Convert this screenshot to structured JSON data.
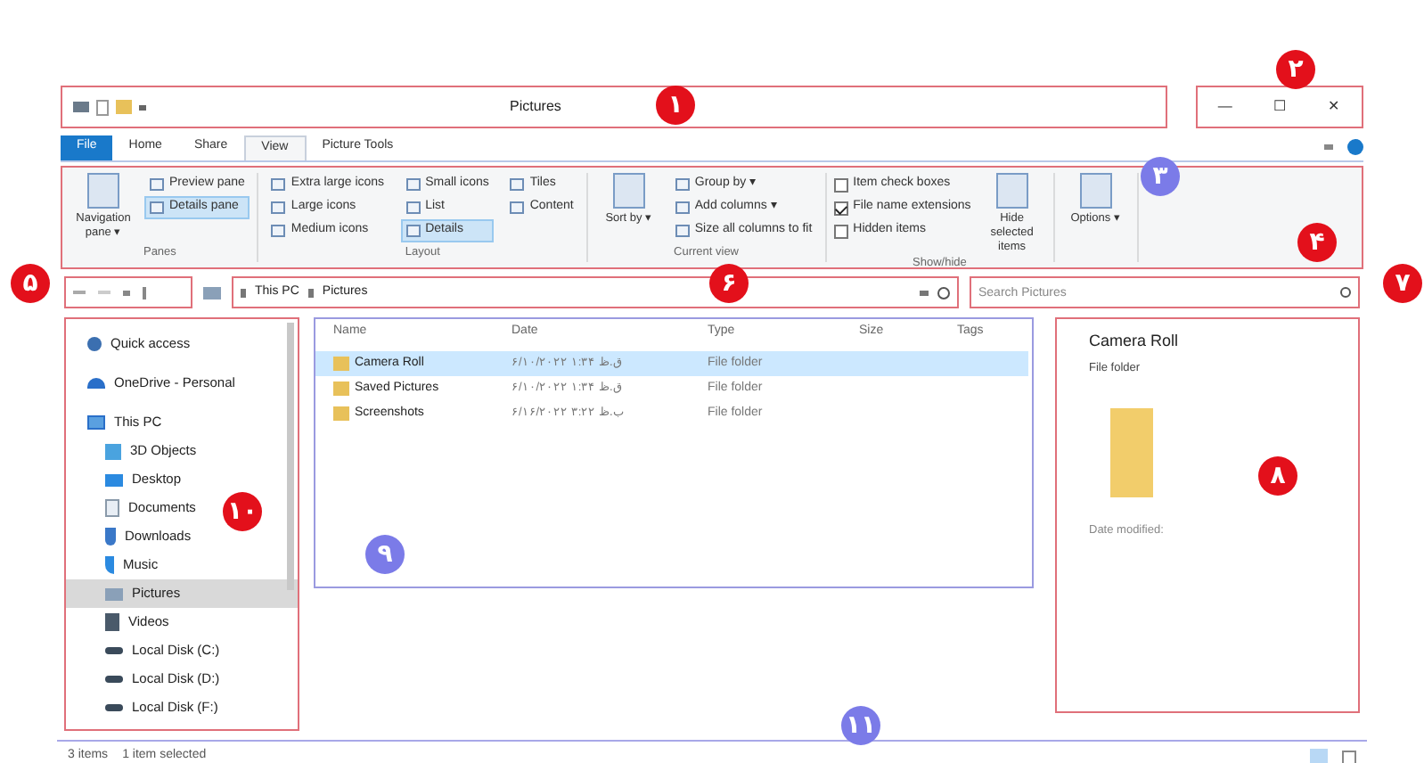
{
  "window": {
    "title": "Pictures",
    "controls": [
      "—",
      "☐",
      "✕"
    ]
  },
  "ribbon_tabs": [
    {
      "label": "File",
      "kind": "file",
      "selected": false
    },
    {
      "label": "Home",
      "kind": "tab",
      "selected": false
    },
    {
      "label": "Share",
      "kind": "tab",
      "selected": false
    },
    {
      "label": "View",
      "kind": "tab",
      "selected": true
    },
    {
      "label": "Picture Tools",
      "kind": "tab",
      "selected": false
    }
  ],
  "ribbon": {
    "groups": [
      {
        "label": "Panes",
        "items": [
          {
            "kind": "big",
            "label": "Navigation pane ▾"
          },
          {
            "kind": "small",
            "label": "Preview pane",
            "selected": false
          },
          {
            "kind": "small",
            "label": "Details pane",
            "selected": true
          }
        ]
      },
      {
        "label": "Layout",
        "items": [
          {
            "kind": "small",
            "label": "Extra large icons",
            "selected": false
          },
          {
            "kind": "small",
            "label": "Large icons",
            "selected": false
          },
          {
            "kind": "small",
            "label": "Medium icons",
            "selected": false
          },
          {
            "kind": "small",
            "label": "Small icons",
            "selected": false
          },
          {
            "kind": "small",
            "label": "List",
            "selected": false
          },
          {
            "kind": "small",
            "label": "Details",
            "selected": true
          },
          {
            "kind": "small",
            "label": "Tiles",
            "selected": false
          },
          {
            "kind": "small",
            "label": "Content",
            "selected": false
          }
        ]
      },
      {
        "label": "Current view",
        "items": [
          {
            "kind": "big",
            "label": "Sort by ▾"
          },
          {
            "kind": "small",
            "label": "Group by ▾",
            "selected": false
          },
          {
            "kind": "small",
            "label": "Add columns ▾",
            "selected": false
          },
          {
            "kind": "small",
            "label": "Size all columns to fit",
            "selected": false
          }
        ]
      },
      {
        "label": "Show/hide",
        "items": [
          {
            "kind": "check",
            "label": "Item check boxes",
            "checked": false
          },
          {
            "kind": "check",
            "label": "File name extensions",
            "checked": true
          },
          {
            "kind": "check",
            "label": "Hidden items",
            "checked": false
          },
          {
            "kind": "big",
            "label": "Hide selected items"
          }
        ]
      },
      {
        "items": [
          {
            "kind": "big",
            "label": "Options ▾"
          }
        ]
      }
    ]
  },
  "address": {
    "path": [
      "This PC",
      "Pictures"
    ],
    "search_placeholder": "Search Pictures"
  },
  "navigation": [
    {
      "label": "Quick access"
    },
    {
      "label": "OneDrive - Personal"
    },
    {
      "label": "This PC",
      "children": [
        {
          "label": "3D Objects",
          "selected": false
        },
        {
          "label": "Desktop",
          "selected": false
        },
        {
          "label": "Documents",
          "selected": false
        },
        {
          "label": "Downloads",
          "selected": false
        },
        {
          "label": "Music",
          "selected": false
        },
        {
          "label": "Pictures",
          "selected": true
        },
        {
          "label": "Videos",
          "selected": false
        },
        {
          "label": "Local Disk (C:)",
          "selected": false
        },
        {
          "label": "Local Disk (D:)",
          "selected": false
        },
        {
          "label": "Local Disk (F:)",
          "selected": false
        }
      ]
    }
  ],
  "table": {
    "columns": [
      "Name",
      "Date",
      "Type",
      "Size",
      "Tags"
    ],
    "rows": [
      {
        "name": "Camera Roll",
        "date": "۶/۱۰/۲۰۲۲ ق.ظ ۱:۳۴",
        "type": "File folder",
        "selected": true
      },
      {
        "name": "Saved Pictures",
        "date": "۶/۱۰/۲۰۲۲ ق.ظ ۱:۳۴",
        "type": "File folder",
        "selected": false
      },
      {
        "name": "Screenshots",
        "date": "۶/۱۶/۲۰۲۲ ب.ظ ۳:۲۲",
        "type": "File folder",
        "selected": false
      }
    ]
  },
  "details": {
    "title": "Camera Roll",
    "subtitle": "File folder",
    "field": "Date modified:"
  },
  "status_bar": {
    "items": "3 items",
    "selection": "1 item selected"
  },
  "callouts": [
    {
      "label": "۲",
      "color": "#e3101b"
    },
    {
      "label": "۱",
      "color": "#e3101b"
    },
    {
      "label": "۳",
      "color": "#7b7be8"
    },
    {
      "label": "۴",
      "color": "#e3101b"
    },
    {
      "label": "۷",
      "color": "#e3101b"
    },
    {
      "label": "۶",
      "color": "#e3101b"
    },
    {
      "label": "۵",
      "color": "#e3101b"
    },
    {
      "label": "۸",
      "color": "#e3101b"
    },
    {
      "label": "۱۰",
      "color": "#e3101b"
    },
    {
      "label": "۹",
      "color": "#7b7be8"
    },
    {
      "label": "۱۱",
      "color": "#7b7be8"
    }
  ]
}
